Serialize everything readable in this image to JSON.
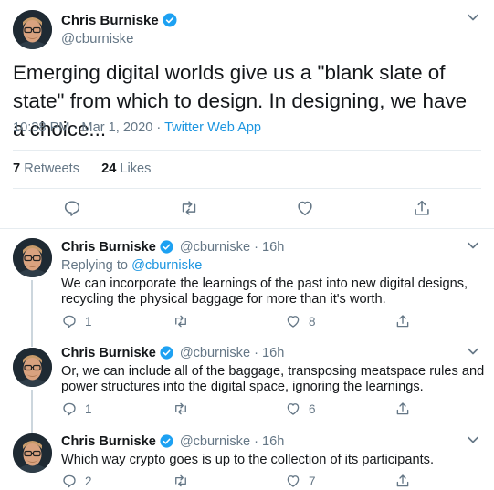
{
  "author": {
    "name": "Chris Burniske",
    "handle": "@cburniske"
  },
  "main_tweet": {
    "text": "Emerging digital worlds give us a \"blank slate of state\" from which to design. In designing, we have a choice...",
    "timestamp": "10:38 PM · Mar 1, 2020",
    "separator": "·",
    "client": "Twitter Web App",
    "retweets_count": "7",
    "retweets_label": "Retweets",
    "likes_count": "24",
    "likes_label": "Likes"
  },
  "replies": [
    {
      "name": "Chris Burniske",
      "handle": "@cburniske",
      "dot": "·",
      "time": "16h",
      "replying_to_label": "Replying to",
      "replying_to_handle": "@cburniske",
      "line1": "We can incorporate the learnings of the past into new digital designs,",
      "line2": "recycling the physical baggage for more than it's worth.",
      "reply_count": "1",
      "retweet_count": "",
      "like_count": "8"
    },
    {
      "name": "Chris Burniske",
      "handle": "@cburniske",
      "dot": "·",
      "time": "16h",
      "line1": "Or, we can include all of the baggage, transposing meatspace rules and",
      "line2": "power structures into the digital space, ignoring the learnings.",
      "reply_count": "1",
      "retweet_count": "",
      "like_count": "6"
    },
    {
      "name": "Chris Burniske",
      "handle": "@cburniske",
      "dot": "·",
      "time": "16h",
      "line1": "Which way crypto goes is up to the collection of its participants.",
      "reply_count": "2",
      "retweet_count": "",
      "like_count": "7"
    }
  ],
  "icons": {
    "verified": "verified-badge-icon",
    "caret": "chevron-down-icon",
    "reply": "reply-icon",
    "retweet": "retweet-icon",
    "like": "heart-icon",
    "share": "share-icon"
  },
  "colors": {
    "accent": "#1da1f2",
    "link": "#1b95e0",
    "muted": "#657786",
    "divider": "#e6ecf0",
    "thread": "#ccd6dd"
  }
}
